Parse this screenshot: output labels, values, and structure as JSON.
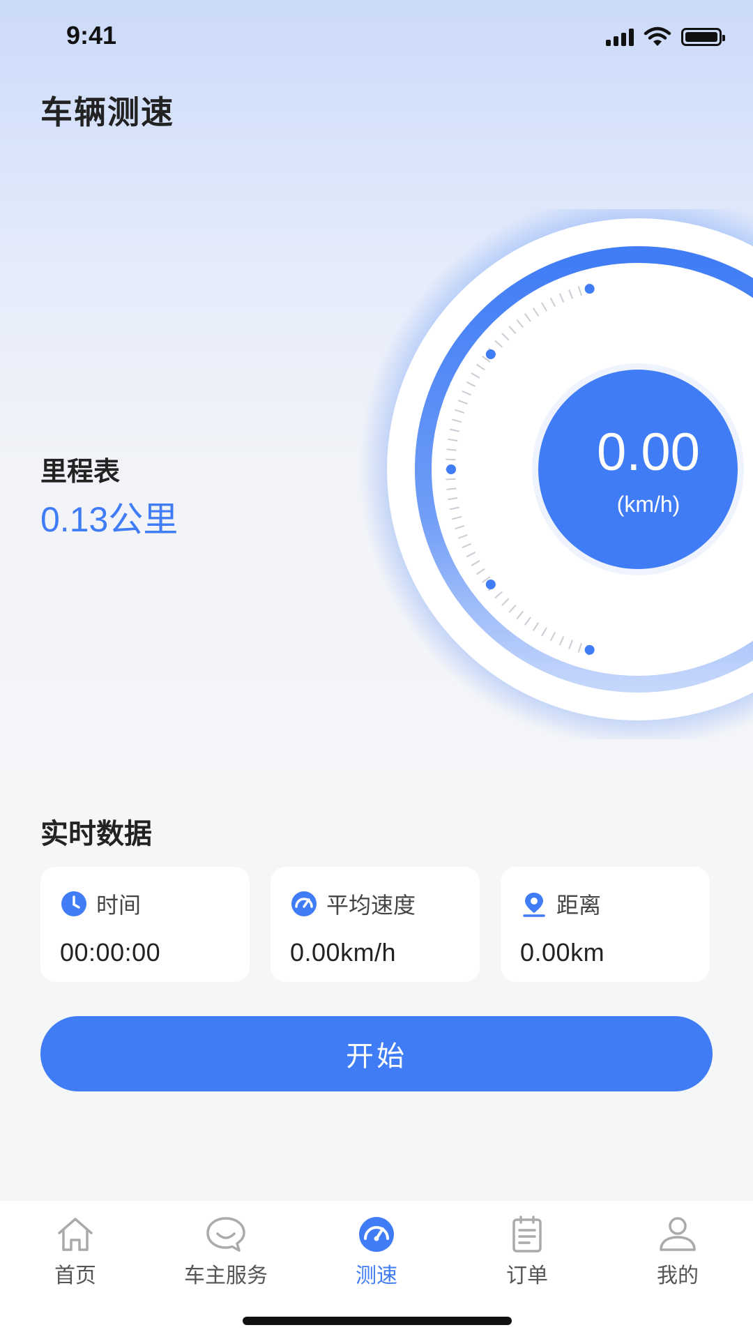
{
  "status": {
    "time": "9:41"
  },
  "header": {
    "title": "车辆测速"
  },
  "odometer": {
    "label": "里程表",
    "value": "0.13公里"
  },
  "gauge": {
    "speed": "0.00",
    "unit": "(km/h)"
  },
  "realtime": {
    "title": "实时数据",
    "cards": [
      {
        "icon": "clock-icon",
        "label": "时间",
        "value": "00:00:00"
      },
      {
        "icon": "speedometer-icon",
        "label": "平均速度",
        "value": "0.00km/h"
      },
      {
        "icon": "location-pin-icon",
        "label": "距离",
        "value": "0.00km"
      }
    ]
  },
  "start_button": {
    "label": "开始"
  },
  "tabs": [
    {
      "icon": "home-icon",
      "label": "首页"
    },
    {
      "icon": "chat-icon",
      "label": "车主服务"
    },
    {
      "icon": "speedometer-icon",
      "label": "测速",
      "active": true
    },
    {
      "icon": "clipboard-icon",
      "label": "订单"
    },
    {
      "icon": "user-icon",
      "label": "我的"
    }
  ],
  "colors": {
    "accent": "#3f7cf5",
    "text": "#222222",
    "background": "#f5f6f8"
  }
}
